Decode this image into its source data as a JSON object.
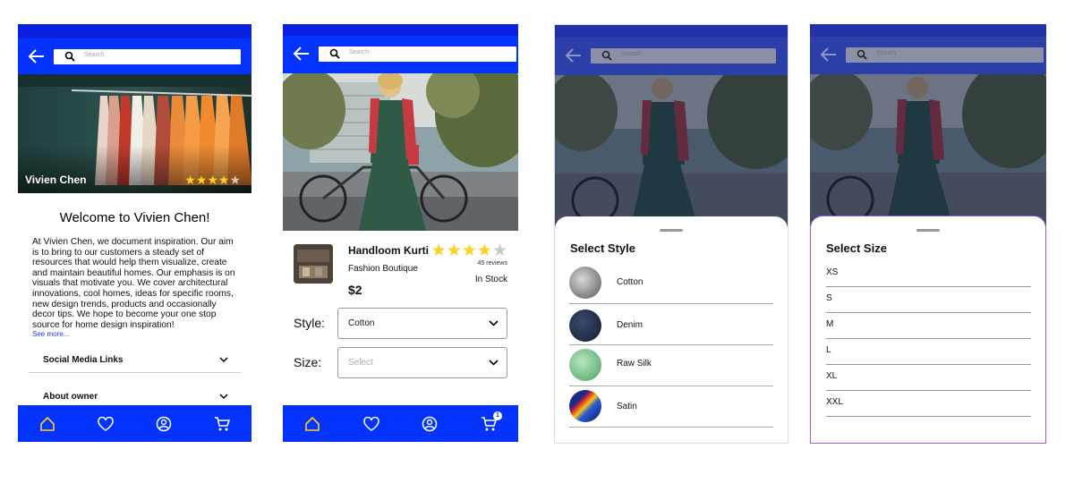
{
  "search": {
    "placeholder": "Search"
  },
  "tabs": {
    "cart_badge": "1"
  },
  "store": {
    "name": "Vivien Chen",
    "rating": 4,
    "welcome": "Welcome to Vivien Chen!",
    "description": "At Vivien Chen, we document inspiration. Our aim is to bring to our customers a steady set of resources that would help them visualize, create and maintain beautiful homes. Our emphasis is on visuals that motivate you. We cover architectural innovations, cool homes, ideas for specific rooms, new design trends, products and occasionally decor tips. We hope to become your one stop source for home design inspiration!",
    "see_more": "See more...",
    "accordions": [
      "Social Media Links",
      "About owner"
    ]
  },
  "product": {
    "title": "Handloom Kurti",
    "store": "Fashion Boutique",
    "price": "$2",
    "rating": 4,
    "reviews": "45 reviews",
    "stock": "In Stock",
    "style_label": "Style:",
    "style_value": "Cotton",
    "size_label": "Size:",
    "size_placeholder": "Select",
    "carousel_count": 3
  },
  "style_sheet": {
    "title": "Select Style",
    "options": [
      {
        "label": "Cotton",
        "swatch": "#8a8a8a"
      },
      {
        "label": "Denim",
        "swatch": "#1e2b4a"
      },
      {
        "label": "Raw Silk",
        "swatch": "#6fbf7e"
      },
      {
        "label": "Satin",
        "swatch": "#2a2a7a"
      }
    ]
  },
  "size_sheet": {
    "title": "Select Size",
    "options": [
      "XS",
      "S",
      "M",
      "L",
      "XL",
      "XXL"
    ]
  },
  "colors": {
    "primary": "#0433ff",
    "status": "#0a1fe0",
    "star": "#ffd21f",
    "accent_border": "#9b5de5"
  }
}
